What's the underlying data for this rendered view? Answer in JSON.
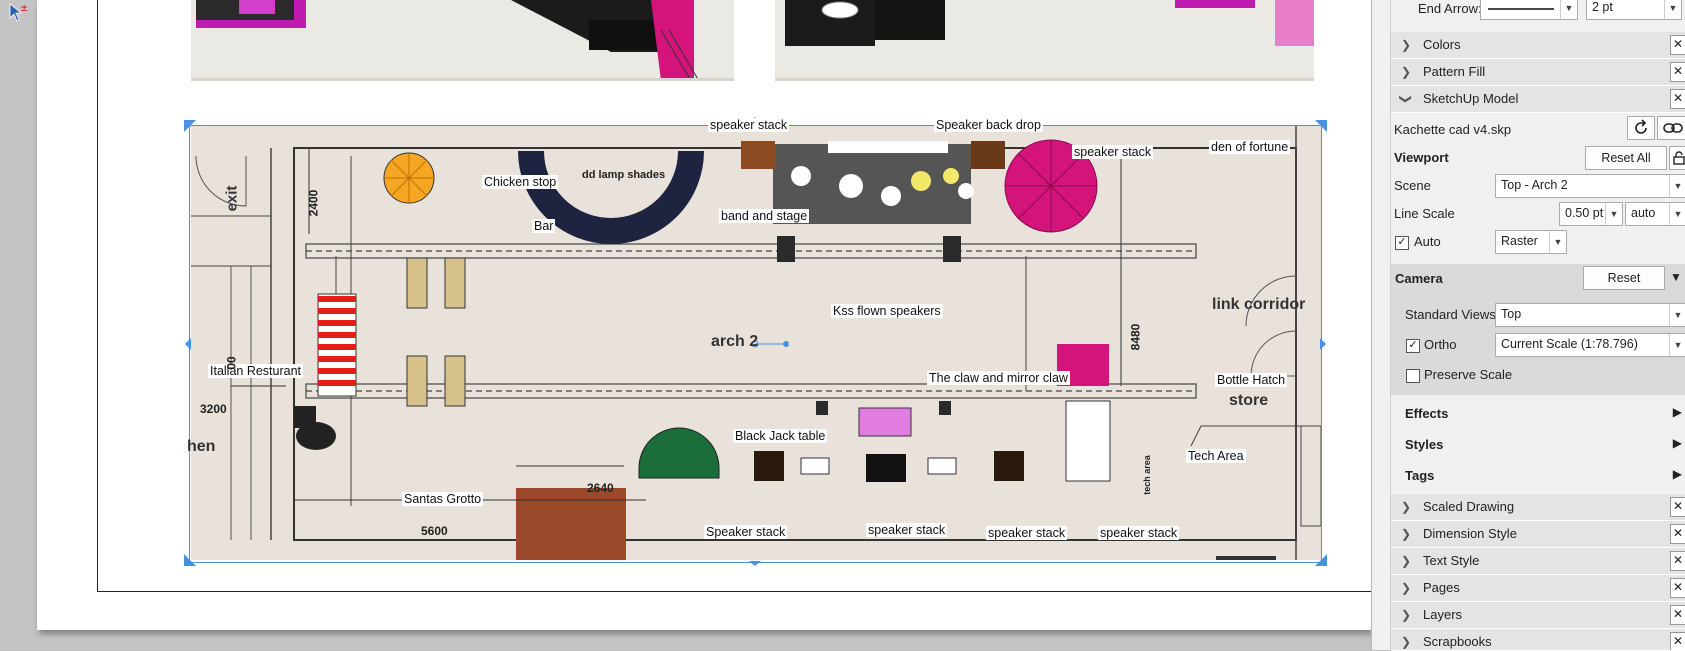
{
  "canvas": {
    "callouts": {
      "speaker_stack_top": "speaker stack",
      "speaker_back_drop": "Speaker back drop",
      "speaker_stack_top_right": "speaker stack",
      "den_of_fortune": "den of fortune",
      "chicken_stop": "Chicken stop",
      "bar": "Bar",
      "band_and_stage": "band and stage",
      "kss_flown_speakers": "Kss flown speakers",
      "italian_resturant": "Italian Resturant",
      "the_claw": "The claw and mirror claw",
      "bottle_hatch": "Bottle Hatch",
      "black_jack_table": "Black Jack table",
      "tech_area": "Tech Area",
      "santas_grotto": "Santas Grotto",
      "speaker_stack_1": "Speaker stack",
      "speaker_stack_2": "speaker stack",
      "speaker_stack_3": "speaker stack",
      "speaker_stack_4": "speaker stack"
    },
    "rooms": {
      "exit": "exit",
      "arch2": "arch 2",
      "link_corridor": "link corridor",
      "store": "store",
      "hen": "hen",
      "lamp_shades": "dd lamp shades",
      "tech_area_wall": "tech area"
    },
    "dimensions": {
      "d2400": "2400",
      "d3200": "3200",
      "d5600": "5600",
      "d2640": "2640",
      "d8480": "8480",
      "d00": "00"
    }
  },
  "panel": {
    "end_arrow": {
      "label": "End Arrow:",
      "weight": "2 pt"
    },
    "sections_top": [
      {
        "label": "Colors",
        "expanded": false
      },
      {
        "label": "Pattern Fill",
        "expanded": false
      },
      {
        "label": "SketchUp Model",
        "expanded": true
      }
    ],
    "model_file": "Kachette cad v4.skp",
    "viewport": {
      "title": "Viewport",
      "reset_all": "Reset All",
      "scene_label": "Scene",
      "scene_value": "Top - Arch 2",
      "line_scale_label": "Line Scale",
      "line_scale_value": "0.50 pt",
      "line_scale_mode": "auto",
      "auto_label": "Auto",
      "render_mode": "Raster"
    },
    "camera": {
      "title": "Camera",
      "reset": "Reset",
      "standard_views_label": "Standard Views",
      "standard_views_value": "Top",
      "ortho_label": "Ortho",
      "ortho_value": "Current Scale (1:78.796)",
      "preserve_scale_label": "Preserve Scale"
    },
    "collapsed_bold": [
      "Effects",
      "Styles",
      "Tags"
    ],
    "sections_bottom": [
      {
        "label": "Scaled Drawing"
      },
      {
        "label": "Dimension Style"
      },
      {
        "label": "Text Style"
      },
      {
        "label": "Pages"
      },
      {
        "label": "Layers"
      },
      {
        "label": "Scrapbooks"
      }
    ],
    "colors": {
      "accent": "#4a90e2",
      "magenta": "#d4147a"
    }
  }
}
